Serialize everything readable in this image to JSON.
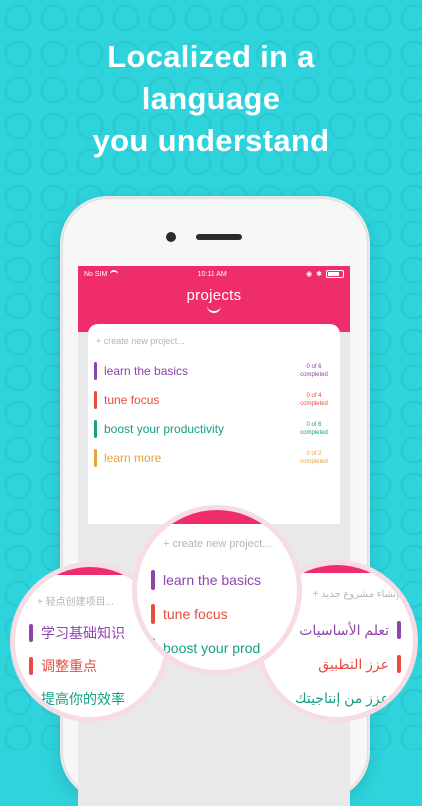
{
  "headline": [
    "Localized in a",
    "language",
    "you understand"
  ],
  "status_bar": {
    "carrier": "No SIM",
    "time": "10:11 AM"
  },
  "app": {
    "title": "projects",
    "placeholder": "+ create new project...",
    "projects": [
      {
        "name": "learn the basics",
        "count": "0 of 6",
        "status": "completed",
        "color": "#8e44ad"
      },
      {
        "name": "tune focus",
        "count": "0 of 4",
        "status": "completed",
        "color": "#e74c3c"
      },
      {
        "name": "boost your productivity",
        "count": "0 of 6",
        "status": "completed",
        "color": "#16a085"
      },
      {
        "name": "learn more",
        "count": "0 of 2",
        "status": "completed",
        "color": "#e6a23c"
      }
    ]
  },
  "lenses": {
    "chinese": {
      "placeholder": "+ 轻点创建项目...",
      "items": [
        "学习基础知识",
        "调整重点",
        "提高你的效率"
      ]
    },
    "english": {
      "placeholder": "+ create new project...",
      "items": [
        "learn the basics",
        "tune focus",
        "boost your prod"
      ]
    },
    "arabic": {
      "placeholder": "+ إنشاء مشروع جديد",
      "items": [
        "تعلم الأساسيات",
        "عزز التطبيق",
        "عزز من إنتاجيتك"
      ]
    }
  },
  "colors": {
    "background": "#2ed3dc",
    "brand_pink": "#ef2d6b"
  }
}
